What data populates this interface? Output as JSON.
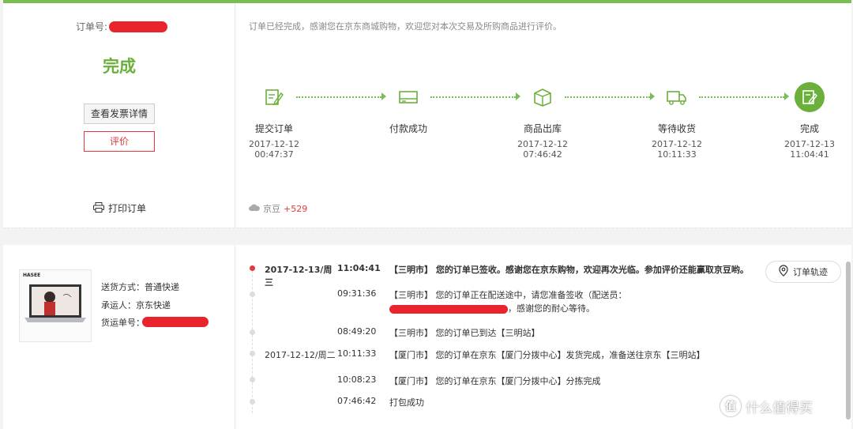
{
  "order": {
    "number_label": "订单号:",
    "status": "完成",
    "invoice_button": "查看发票详情",
    "review_button": "评价",
    "print_label": "打印订单",
    "thanks_message": "订单已经完成，感谢您在京东商城购物，欢迎您对本次交易及所购商品进行评价。",
    "jd_bean_label": "京豆",
    "jd_bean_value": "+529"
  },
  "progress": {
    "steps": [
      {
        "label": "提交订单",
        "date": "2017-12-12",
        "time": "00:47:37",
        "icon": "edit-doc-icon"
      },
      {
        "label": "付款成功",
        "date": "",
        "time": "",
        "icon": "card-icon"
      },
      {
        "label": "商品出库",
        "date": "2017-12-12",
        "time": "07:46:42",
        "icon": "box-icon"
      },
      {
        "label": "等待收货",
        "date": "2017-12-12",
        "time": "10:11:33",
        "icon": "truck-icon"
      },
      {
        "label": "完成",
        "date": "2017-12-13",
        "time": "11:04:41",
        "icon": "done-doc-icon"
      }
    ],
    "accent_color": "#6ab03a"
  },
  "shipping": {
    "method_label": "送货方式：",
    "method_value": "普通快递",
    "carrier_label": "承运人：",
    "carrier_value": "京东快递",
    "tracking_label": "货运单号：",
    "thumb_brand": "HASEE"
  },
  "tracking": {
    "button_label": "订单轨迹",
    "events": [
      {
        "date": "2017-12-13/周三",
        "time": "11:04:41",
        "message": "【三明市】 您的订单已签收。感谢您在京东购物，欢迎再次光临。参加评价还能赢取京豆哟。"
      },
      {
        "date": "",
        "time": "09:31:36",
        "message": "【三明市】 您的订单正在配送途中，请您准备签收（配送员：",
        "message_tail": "，感谢您的耐心等待。"
      },
      {
        "date": "",
        "time": "08:49:20",
        "message": "【三明市】 您的订单已到达【三明站】"
      },
      {
        "date": "2017-12-12/周二",
        "time": "10:11:33",
        "message": "【厦门市】 您的订单在京东【厦门分拨中心】发货完成，准备送往京东【三明站】"
      },
      {
        "date": "",
        "time": "10:08:23",
        "message": "【厦门市】 您的订单在京东【厦门分拨中心】分拣完成"
      },
      {
        "date": "",
        "time": "07:46:42",
        "message": "打包成功"
      }
    ]
  },
  "watermark": {
    "text": "什么值得买",
    "logo": "值"
  }
}
